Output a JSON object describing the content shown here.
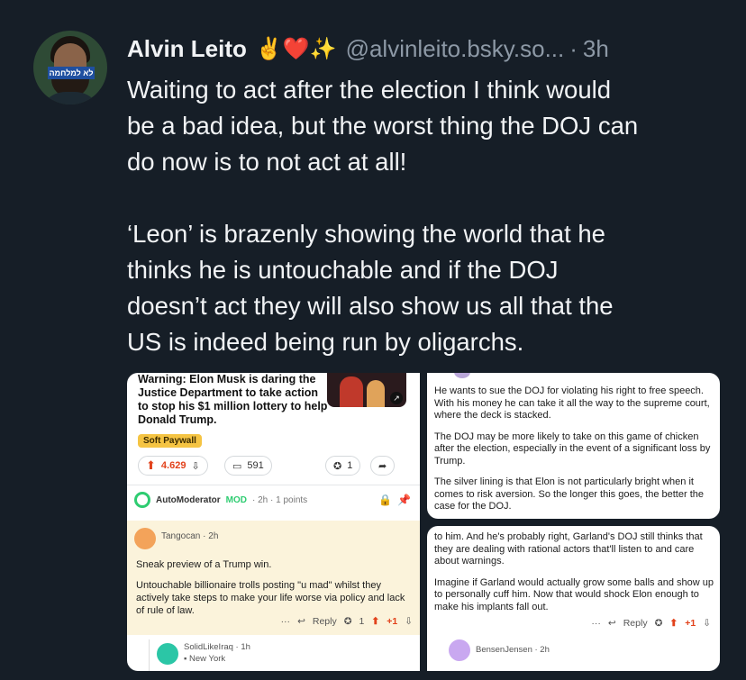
{
  "post": {
    "author_name": "Alvin Leito",
    "author_emojis": "✌️❤️✨",
    "handle": "@alvinleito.bsky.so...",
    "separator": "·",
    "time": "3h",
    "avatar_band_text": "לא למלחמה",
    "paragraphs": [
      "Waiting to act after the election I think would\nbe a bad idea, but the worst thing the DOJ can\ndo now is to not act at all!",
      "‘Leon’ is brazenly showing the world that he\nthinks he is untouchable and if the DOJ\ndoesn’t act they will also show us all that the\nUS is indeed being run by oligarchs."
    ]
  },
  "img_left": {
    "article_title": "Warning: Elon Musk is daring the Justice Department to take action to stop his $1 million lottery to help Donald Trump.",
    "badge": "Soft Paywall",
    "upvotes": "4.629",
    "comments": "591",
    "awards": "1",
    "automod": {
      "name": "AutoModerator",
      "tag": "MOD",
      "meta": "· 2h · 1 points"
    },
    "comment": {
      "author": "Tangocan · 2h",
      "lines": [
        "Sneak preview of a Trump win.",
        "Untouchable billionaire trolls posting \"u mad\" whilst they actively take steps to make your life worse via policy and lack of rule of law."
      ],
      "reply": "Reply",
      "award_count": "1",
      "score": "+1"
    },
    "sub": {
      "author": "SolidLikeIraq · 1h",
      "location": "New York"
    }
  },
  "img_right_top": {
    "paragraphs": [
      "He wants to sue the DOJ for violating his right to free speech. With his money he can take it all the way to the supreme court, where the deck is stacked.",
      "The DOJ may be more likely to take on this game of chicken after the election, especially in the event of a significant loss by Trump.",
      "The silver lining is that Elon is not particularly bright when it comes to risk aversion. So the longer this goes, the better the case for the DOJ."
    ]
  },
  "img_right_bottom": {
    "paragraphs": [
      "to him. And he's probably right, Garland's DOJ still thinks that they are dealing with rational actors that'll listen to and care about warnings.",
      "Imagine if Garland would actually grow some balls and show up to personally cuff him. Now that would shock Elon enough to make his implants fall out."
    ],
    "reply": "Reply",
    "score": "+1",
    "next_author": "BensenJensen · 2h"
  }
}
